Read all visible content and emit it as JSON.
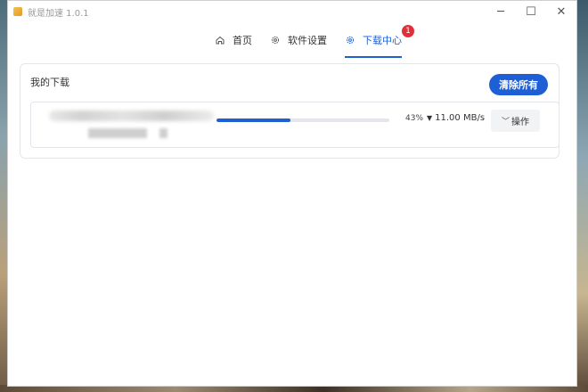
{
  "window": {
    "title": "就是加速  1.0.1",
    "controls": {
      "minimize": "─",
      "maximize": "☐",
      "close": "✕"
    }
  },
  "nav": {
    "tabs": [
      {
        "label": "首页",
        "icon": "home-icon",
        "active": false
      },
      {
        "label": "软件设置",
        "icon": "gear-icon",
        "active": false
      },
      {
        "label": "下载中心",
        "icon": "gear-icon",
        "active": true,
        "badge": "1"
      }
    ]
  },
  "downloads": {
    "title": "我的下载",
    "clear_label": "清除所有",
    "items": [
      {
        "progress_percent": 43,
        "percent_label": "43%",
        "speed_label": "11.00 MB/s",
        "action_label": "操作"
      }
    ]
  },
  "colors": {
    "accent": "#1f5fd6",
    "badge": "#e0303a"
  }
}
